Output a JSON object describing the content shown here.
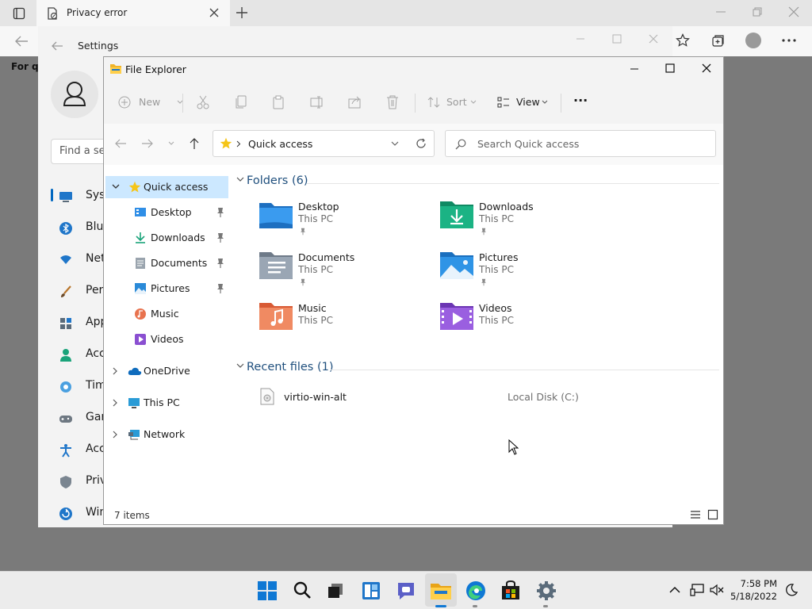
{
  "browser": {
    "tab_title": "Privacy error",
    "page_text": "For qu"
  },
  "settings": {
    "title": "Settings",
    "search_placeholder": "Find a se",
    "nav": [
      {
        "label": "Syst",
        "icon": "monitor-icon"
      },
      {
        "label": "Blue",
        "icon": "bluetooth-icon"
      },
      {
        "label": "Net",
        "icon": "wifi-icon"
      },
      {
        "label": "Pers",
        "icon": "brush-icon"
      },
      {
        "label": "App",
        "icon": "apps-icon"
      },
      {
        "label": "Acc",
        "icon": "person-icon"
      },
      {
        "label": "Tim",
        "icon": "clock-globe-icon"
      },
      {
        "label": "Gar",
        "icon": "gamepad-icon"
      },
      {
        "label": "Acc",
        "icon": "accessibility-icon"
      },
      {
        "label": "Priv",
        "icon": "shield-icon"
      },
      {
        "label": "Win",
        "icon": "update-icon"
      }
    ]
  },
  "explorer": {
    "title": "File Explorer",
    "commands": {
      "new": "New",
      "sort": "Sort",
      "view": "View",
      "more": "···"
    },
    "address": "Quick access",
    "search_placeholder": "Search Quick access",
    "tree": [
      {
        "label": "Quick access",
        "level": 0,
        "expanded": true,
        "selected": true,
        "icon": "star-icon"
      },
      {
        "label": "Desktop",
        "level": 1,
        "pinned": true,
        "icon": "desktop-folder-icon"
      },
      {
        "label": "Downloads",
        "level": 1,
        "pinned": true,
        "icon": "download-arrow-icon"
      },
      {
        "label": "Documents",
        "level": 1,
        "pinned": true,
        "icon": "document-icon"
      },
      {
        "label": "Pictures",
        "level": 1,
        "pinned": true,
        "icon": "picture-icon"
      },
      {
        "label": "Music",
        "level": 1,
        "pinned": false,
        "icon": "music-icon"
      },
      {
        "label": "Videos",
        "level": 1,
        "pinned": false,
        "icon": "video-icon"
      },
      {
        "label": "OneDrive",
        "level": 0,
        "expanded": false,
        "icon": "cloud-icon"
      },
      {
        "label": "This PC",
        "level": 0,
        "expanded": false,
        "icon": "computer-icon"
      },
      {
        "label": "Network",
        "level": 0,
        "expanded": false,
        "icon": "network-icon"
      }
    ],
    "folders_header": "Folders (6)",
    "folders": [
      {
        "name": "Desktop",
        "location": "This PC",
        "pinned": true,
        "icon": "desktop-folder-icon",
        "color": "#2f8ee6"
      },
      {
        "name": "Downloads",
        "location": "This PC",
        "pinned": true,
        "icon": "downloads-folder-icon",
        "color": "#1aa37a"
      },
      {
        "name": "Documents",
        "location": "This PC",
        "pinned": true,
        "icon": "documents-folder-icon",
        "color": "#8e9aa8"
      },
      {
        "name": "Pictures",
        "location": "This PC",
        "pinned": true,
        "icon": "pictures-folder-icon",
        "color": "#2a8ad8"
      },
      {
        "name": "Music",
        "location": "This PC",
        "pinned": false,
        "icon": "music-folder-icon",
        "color": "#e8734f"
      },
      {
        "name": "Videos",
        "location": "This PC",
        "pinned": false,
        "icon": "videos-folder-icon",
        "color": "#8a4fd1"
      }
    ],
    "recent_header": "Recent files (1)",
    "recent": [
      {
        "name": "virtio-win-alt",
        "location": "Local Disk (C:)",
        "icon": "disc-file-icon"
      }
    ],
    "status": "7 items"
  },
  "taskbar": {
    "time": "7:58 PM",
    "date": "5/18/2022"
  }
}
